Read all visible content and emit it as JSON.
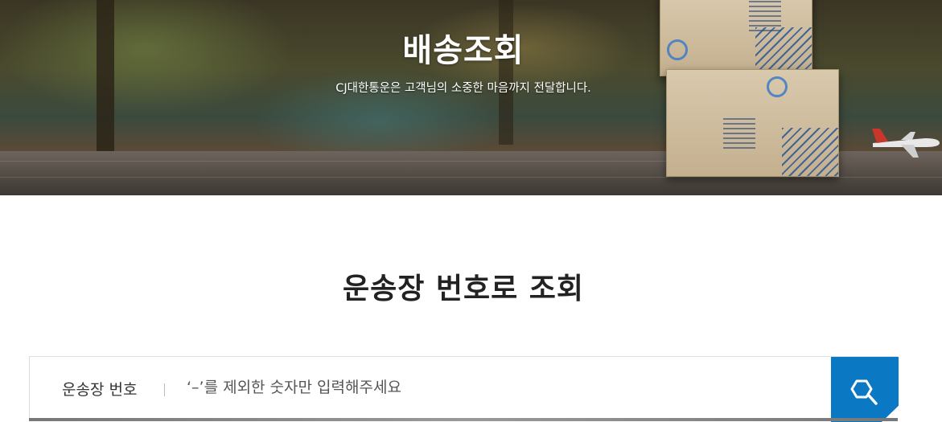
{
  "hero": {
    "title": "배송조회",
    "subtitle": "CJ대한통운은 고객님의 소중한 마음까지 전달합니다."
  },
  "tracking": {
    "section_title": "운송장 번호로 조회",
    "label": "운송장 번호",
    "input_placeholder": "‘–’를 제외한 숫자만 입력해주세요",
    "input_value": "",
    "search_icon": "search-icon",
    "accent_color": "#0b78c4"
  }
}
